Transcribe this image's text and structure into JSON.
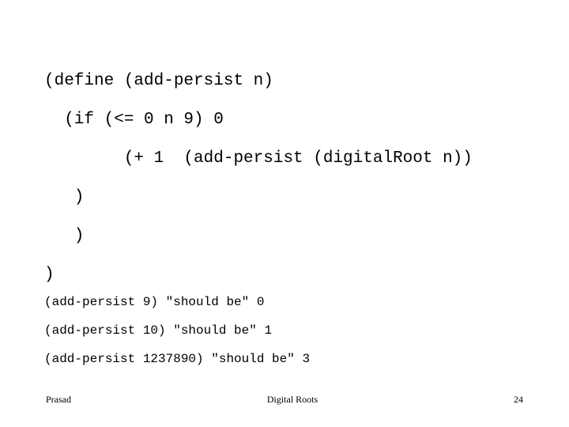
{
  "slide": {
    "background_color": "#ffffff",
    "text_color": "#000000",
    "page_number": "24"
  },
  "code": {
    "lines": [
      "(define (add-persist n)",
      "  (if (<= 0 n 9) 0",
      "        (+ 1  (add-persist (digitalRoot n))",
      "   )",
      "   )",
      ")"
    ]
  },
  "tests": {
    "lines": [
      "(add-persist 9) \"should be\" 0",
      "(add-persist 10) \"should be\" 1",
      "(add-persist 1237890) \"should be\" 3"
    ]
  },
  "footer": {
    "author": "Prasad",
    "title": "Digital Roots",
    "page": "24"
  }
}
